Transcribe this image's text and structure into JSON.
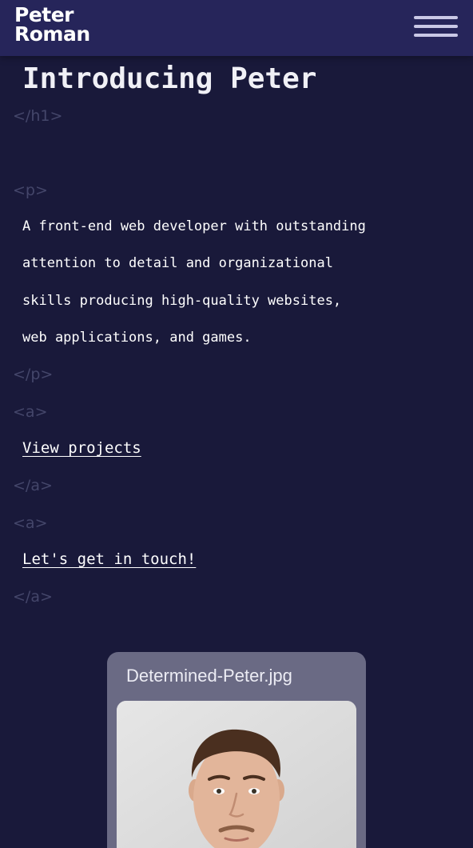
{
  "header": {
    "logo_line1": "Peter",
    "logo_line2": "Roman",
    "menu_icon": "hamburger-menu-icon"
  },
  "hero": {
    "heading": "Introducing Peter",
    "h1_close_tag": "</h1>",
    "p_open_tag": "<p>",
    "paragraph_lines": [
      "A front-end web developer with outstanding",
      "attention to detail and organizational",
      "skills producing high-quality websites,",
      "web applications, and games."
    ],
    "p_close_tag": "</p>",
    "a_open_tag": "<a>",
    "a_close_tag": "</a>",
    "link_projects": "View projects",
    "link_contact": "Let's get in touch!"
  },
  "image_window": {
    "title": "Determined-Peter.jpg"
  },
  "colors": {
    "background": "#19193a",
    "header": "#26255a",
    "tag": "#44466a",
    "card": "#6a6a84"
  }
}
